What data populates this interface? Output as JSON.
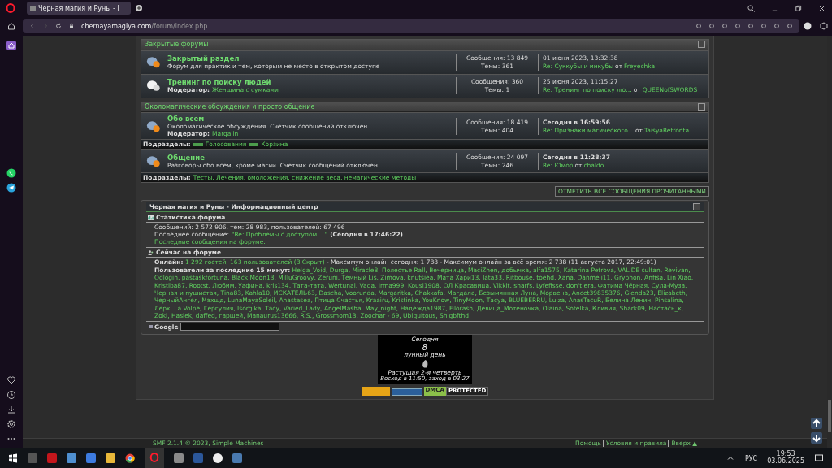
{
  "browser": {
    "tab_title": "Черная магия и Руны - І",
    "url_host": "chernayamagiya.com",
    "url_path": "/forum/index.php"
  },
  "sections": [
    {
      "title": "Закрытые форумы",
      "boards": [
        {
          "name": "Закрытый раздел",
          "new": true,
          "description": "Форум для практик и тем, которым не место в открытом доступе",
          "posts": "Сообщения: 13 849",
          "topics": "Темы: 361",
          "last_time": "01 июня 2023, 13:32:38",
          "today": false,
          "last_post": "Re: Суккубы и инкубы",
          "by": "от",
          "last_author": "Freyechka"
        },
        {
          "name": "Тренинг по поиску людей",
          "new": false,
          "moderator_label": "Модератор:",
          "moderator": "Женщина с сумками",
          "posts": "Сообщения: 360",
          "topics": "Темы: 1",
          "last_time": "25 июня 2023, 11:15:27",
          "today": false,
          "last_post": "Re: Тренинг по поиску лю…",
          "by": "от",
          "last_author": "QUEENofSWORDS"
        }
      ]
    },
    {
      "title": "Околомагические обсуждения и просто общение",
      "boards": [
        {
          "name": "Обо всем",
          "new": true,
          "description": "Околомагическое обсуждения. Счетчик сообщений отключен.",
          "moderator_label": "Модератор:",
          "moderator": "Margalin",
          "posts": "Сообщения: 18 419",
          "topics": "Темы: 404",
          "last_time": "Сегодня в 16:59:56",
          "today": true,
          "last_post": "Re: Признаки магического...",
          "by": "от",
          "last_author": "TaisyaRetronta",
          "subboards_label": "Подразделы:",
          "subboards": [
            {
              "name": "Голосования",
              "new": true
            },
            {
              "name": "Корзина",
              "new": true
            }
          ]
        },
        {
          "name": "Общение",
          "new": true,
          "description": "Разговоры обо всем, кроме магии. Счетчик сообщений отключен.",
          "posts": "Сообщения: 24 097",
          "topics": "Темы: 246",
          "last_time": "Сегодня в 11:28:37",
          "today": true,
          "last_post": "Re: Юмор",
          "by": "от",
          "last_author": "chaldo",
          "subboards_label": "Подразделы:",
          "subboards": [
            {
              "name": "Тесты, Лечения, омоложения, снижение веса, немагические методы",
              "new": false
            }
          ]
        }
      ]
    }
  ],
  "mark_read_button": "ОТМЕТИТЬ ВСЕ СООБЩЕНИЯ ПРОЧИТАННЫМИ",
  "info_center": {
    "title": "Черная магия и Руны - Информационный центр",
    "stats": {
      "title": "Статистика форума",
      "line": "Сообщений: 2 572 906, тем: 28 983, пользователей: 67 496",
      "last_label": "Последнее сообщение:",
      "last_link": "\"Re: Проблемы с доступом ...\"",
      "last_time": "(Сегодня в 17:46:22)",
      "recent_link": "Последние сообщения на форуме."
    },
    "online": {
      "title": "Сейчас на форуме",
      "online_label": "Онлайн:",
      "online_link": "1 292 гостей, 163 пользователей (3 Скрыт)",
      "max_text": "- Максимум онлайн сегодня: 1 788 - Максимум онлайн за всё время: 2 738 (11 августа 2017, 22:49:01)",
      "users_label": "Пользователи за последние 15 минут:",
      "users": "Helga_Void, Durga, Miracle8, Полестье Rall, Вечерница, MaciZhen, добычка, alfa1575, Katarina Petrova, VALIDE sultan, Revivan, Odlogin, pastaskfortuna, Black Moon13, MilluGroovy, Zeruni, Темный Lis, Zimova, knutsiea, Мата Хари13, lata33, Ritbouse, toehd, Xana, Danmeli11, Gryphon, Anfisa, Lin Xiao, Kristiba87, Rootst, Любим, Уафина, kris134, Тата-тата, Wertunal, Vada, Irma999, Kousi1908, ОЛ Красавица, Vikkit, sharfs, Lyfefisse, don't era, Фатима Чёрная, Сула-Муза, Черная и пушистая, Tina83, Kahla10, ИСКАТЕЛЬ63, Dascha, Voorunda, Margaritka, Chakkafa, Магдала, Безымянная Луна, Морвена, Ancet39835376, Glenda23, Elizabeth, ЧерныйАнгел, Мэхшд, LunaMayaSoleil, Anastasea, Птица Счастья, Kraairu, Kristinka, YouKnow, TinyMoon, Тасуа, BLUEBERRU, Luiza, AnasTacuR, Белина Ленин, Pinsalina, Лерк, La Volpe, Гергулия, Isorgika, Тасу, Varied_Lady, AngelMasha, May_night, Надежда1987, Filorash, Девица_Мотеночка, Olaina, Sotelka, Кливия, Shark09, Настась_к, Zoki, Haslek, daffed, гаршей, Manaurus13666, R.S., Grossmom13, Zoochar - 69, Ubiquitous, Shigbfthd"
    },
    "google_label": "Google"
  },
  "moon": {
    "today": "Сегодня",
    "day": "8",
    "day_label": "лунный день",
    "phase": "Растущая  2-я четверть",
    "rise_set": "Восход в 11:50, заход в 03:27"
  },
  "badge": {
    "left": "DMCA",
    "right": "PROTECTED"
  },
  "footer": {
    "copyright": "SMF 2.1.4 © 2023, Simple Machines",
    "links": [
      "Помощь",
      "Условия и правила",
      "Вверх ▲"
    ]
  },
  "taskbar": {
    "lang": "РУС",
    "time": "19:53",
    "date": "03.06.2025"
  }
}
